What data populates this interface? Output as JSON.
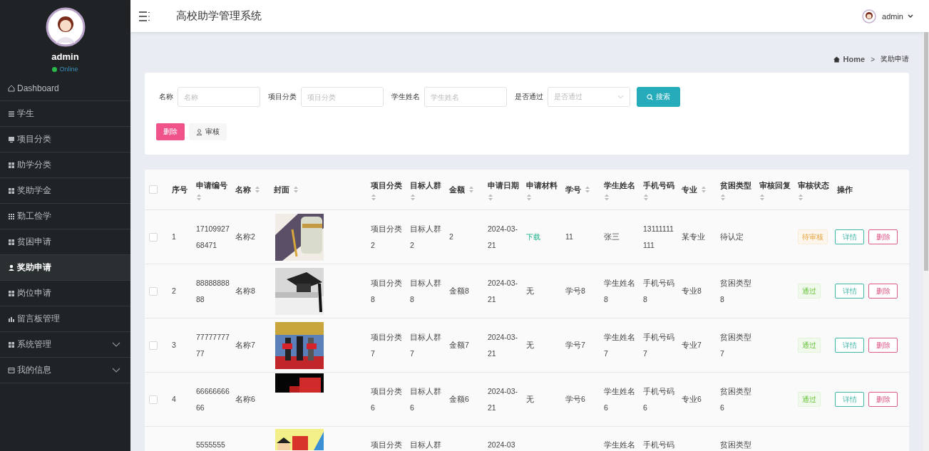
{
  "sidebar": {
    "user": {
      "name": "admin",
      "status": "Online"
    },
    "items": [
      {
        "label": "Dashboard",
        "kind": "home",
        "selected": false,
        "expandable": false
      },
      {
        "label": "学生",
        "kind": "list",
        "selected": false,
        "expandable": false
      },
      {
        "label": "项目分类",
        "kind": "monitor",
        "selected": false,
        "expandable": false
      },
      {
        "label": "助学分类",
        "kind": "grid",
        "selected": false,
        "expandable": false
      },
      {
        "label": "奖助学金",
        "kind": "grid",
        "selected": false,
        "expandable": false
      },
      {
        "label": "勤工俭学",
        "kind": "grid9",
        "selected": false,
        "expandable": false
      },
      {
        "label": "贫困申请",
        "kind": "grid",
        "selected": false,
        "expandable": false
      },
      {
        "label": "奖助申请",
        "kind": "user",
        "selected": true,
        "expandable": false
      },
      {
        "label": "岗位申请",
        "kind": "grid",
        "selected": false,
        "expandable": false
      },
      {
        "label": "留言板管理",
        "kind": "bars",
        "selected": false,
        "expandable": false
      },
      {
        "label": "系统管理",
        "kind": "grid",
        "selected": false,
        "expandable": true
      },
      {
        "label": "我的信息",
        "kind": "card",
        "selected": false,
        "expandable": true
      }
    ]
  },
  "header": {
    "title": "高校助学管理系统",
    "user": "admin"
  },
  "breadcrumb": {
    "home": "Home",
    "separator": ">",
    "current": "奖助申请"
  },
  "search": {
    "fields": [
      {
        "label": "名称",
        "placeholder": "名称",
        "kind": "input"
      },
      {
        "label": "项目分类",
        "placeholder": "项目分类",
        "kind": "input"
      },
      {
        "label": "学生姓名",
        "placeholder": "学生姓名",
        "kind": "input"
      },
      {
        "label": "是否通过",
        "placeholder": "是否通过",
        "kind": "select"
      }
    ],
    "button": "搜索",
    "actions": [
      {
        "label": "删除",
        "kind": "danger"
      },
      {
        "label": "审核",
        "kind": "plain"
      }
    ]
  },
  "table": {
    "select_all": {
      "checked": false
    },
    "columns": [
      {
        "label": "序号",
        "sortable": false
      },
      {
        "label": "申请编号",
        "sortable": true
      },
      {
        "label": "名称",
        "sortable": true
      },
      {
        "label": "封面",
        "sortable": true
      },
      {
        "label": "项目分类",
        "sortable": true
      },
      {
        "label": "目标人群",
        "sortable": true
      },
      {
        "label": "金额",
        "sortable": true
      },
      {
        "label": "申请日期",
        "sortable": true
      },
      {
        "label": "申请材料",
        "sortable": true
      },
      {
        "label": "学号",
        "sortable": true
      },
      {
        "label": "学生姓名",
        "sortable": true
      },
      {
        "label": "手机号码",
        "sortable": true
      },
      {
        "label": "专业",
        "sortable": true
      },
      {
        "label": "贫困类型",
        "sortable": true
      },
      {
        "label": "审核回复",
        "sortable": true
      },
      {
        "label": "审核状态",
        "sortable": true
      },
      {
        "label": "操作",
        "sortable": false
      }
    ],
    "rows": [
      {
        "checked": false,
        "index": "1",
        "code": "1710992768471",
        "name": "名称2",
        "category": "项目分类2",
        "target": "目标人群2",
        "amount": "2",
        "date": "2024-03-21",
        "material": {
          "text": "下载",
          "kind": "link"
        },
        "student_no": "11",
        "student_name": "张三",
        "phone": "13111111111",
        "major": "某专业",
        "poverty": "待认定",
        "status": {
          "text": "待审核",
          "kind": "pending"
        },
        "actions": [
          "详情",
          "删除"
        ]
      },
      {
        "checked": false,
        "index": "2",
        "code": "8888888888",
        "name": "名称8",
        "category": "项目分类8",
        "target": "目标人群8",
        "amount": "金额8",
        "date": "2024-03-21",
        "material": {
          "text": "无",
          "kind": "text"
        },
        "student_no": "学号8",
        "student_name": "学生姓名8",
        "phone": "手机号码8",
        "major": "专业8",
        "poverty": "贫困类型8",
        "status": {
          "text": "通过",
          "kind": "passed"
        },
        "actions": [
          "详情",
          "删除"
        ]
      },
      {
        "checked": false,
        "index": "3",
        "code": "7777777777",
        "name": "名称7",
        "category": "项目分类7",
        "target": "目标人群7",
        "amount": "金额7",
        "date": "2024-03-21",
        "material": {
          "text": "无",
          "kind": "text"
        },
        "student_no": "学号7",
        "student_name": "学生姓名7",
        "phone": "手机号码7",
        "major": "专业7",
        "poverty": "贫困类型7",
        "status": {
          "text": "通过",
          "kind": "passed"
        },
        "actions": [
          "详情",
          "删除"
        ]
      },
      {
        "checked": false,
        "index": "4",
        "code": "6666666666",
        "name": "名称6",
        "category": "项目分类6",
        "target": "目标人群6",
        "amount": "金额6",
        "date": "2024-03-21",
        "material": {
          "text": "无",
          "kind": "text"
        },
        "student_no": "学号6",
        "student_name": "学生姓名6",
        "phone": "手机号码6",
        "major": "专业6",
        "poverty": "贫困类型6",
        "status": {
          "text": "通过",
          "kind": "passed"
        },
        "actions": [
          "详情",
          "删除"
        ]
      },
      {
        "code": "5555555",
        "category": "项目分类",
        "target": "目标人群",
        "date": "2024-03",
        "student_name": "学生姓名",
        "phone": "手机号码",
        "poverty": "贫困类型"
      }
    ]
  }
}
